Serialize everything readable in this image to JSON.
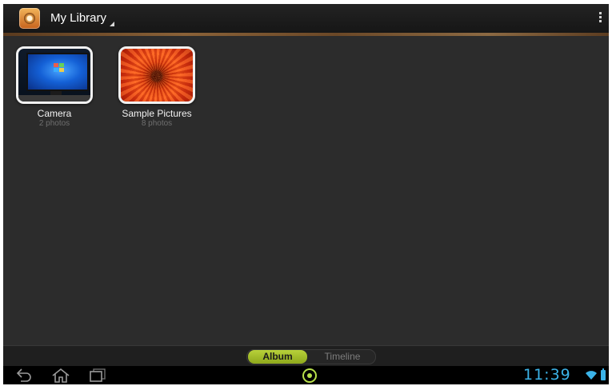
{
  "header": {
    "title": "My Library",
    "app_icon": "gallery-app-icon",
    "menu_icon": "overflow-menu-icon"
  },
  "albums": [
    {
      "name": "Camera",
      "count": "2 photos",
      "thumbnail": "monitor-photo"
    },
    {
      "name": "Sample Pictures",
      "count": "8 photos",
      "thumbnail": "red-flower-photo"
    }
  ],
  "tabs": {
    "album": "Album",
    "timeline": "Timeline",
    "selected": "Album"
  },
  "system_bar": {
    "time": "11:39",
    "icons": [
      "back-icon",
      "home-icon",
      "recent-apps-icon",
      "launcher-icon",
      "wifi-icon",
      "battery-icon"
    ]
  },
  "colors": {
    "accent": "#b8d13a",
    "clock": "#3bb3e8",
    "background": "#2c2c2c"
  }
}
